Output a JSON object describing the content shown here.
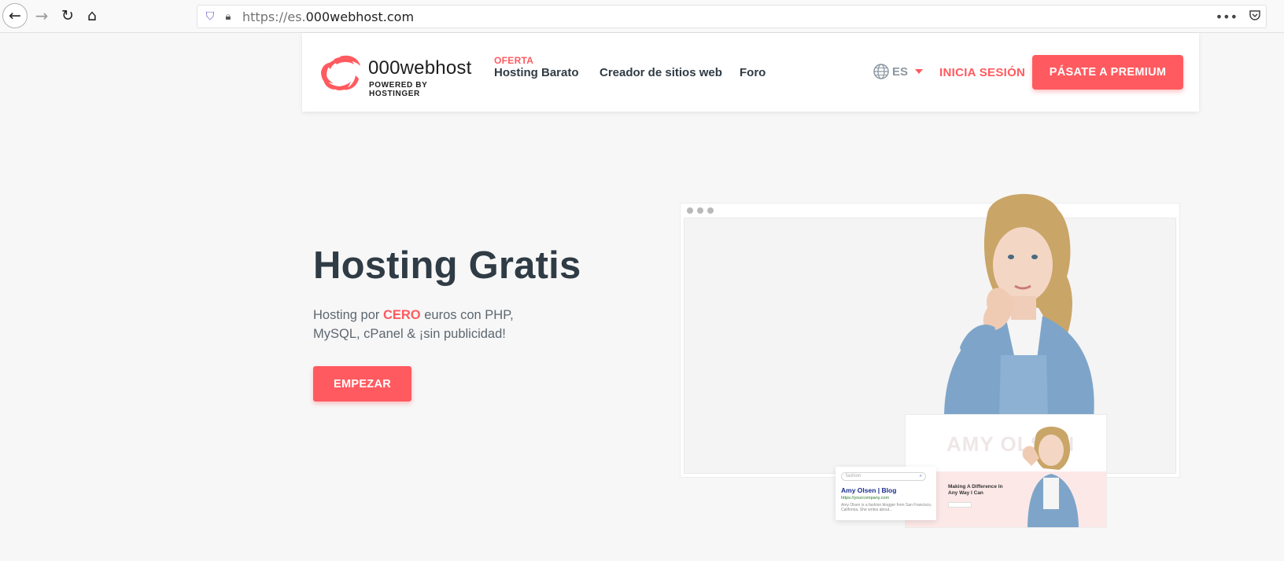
{
  "browser": {
    "url_protocol": "https://es.",
    "url_domain": "000webhost.com"
  },
  "header": {
    "logo_name": "000webhost",
    "logo_tagline": "POWERED BY HOSTINGER",
    "nav": {
      "offer_tag": "OFERTA",
      "hosting": "Hosting Barato",
      "creator": "Creador de sitios web",
      "forum": "Foro"
    },
    "language": "ES",
    "login": "INICIA SESIÓN",
    "premium": "PÁSATE A PREMIUM"
  },
  "hero": {
    "title": "Hosting Gratis",
    "subtitle_before": "Hosting por ",
    "subtitle_highlight": "CERO",
    "subtitle_after": " euros con PHP, MySQL, cPanel & ¡sin publicidad!",
    "cta": "EMPEZAR"
  },
  "illustration": {
    "mini_site_name": "AMY OLSEN",
    "mini_site_caption": "Making A Difference In Any Way I Can",
    "search_placeholder": "fashion",
    "search_result_title": "Amy Olsen | Blog",
    "search_result_url": "https://yourcompany.com",
    "search_result_snippet": "Amy Olsen is a fashion blogger from San Francisco, California. She writes about..."
  },
  "colors": {
    "accent": "#ff5a5f",
    "text": "#2f3b45",
    "background": "#f7f7f7"
  }
}
